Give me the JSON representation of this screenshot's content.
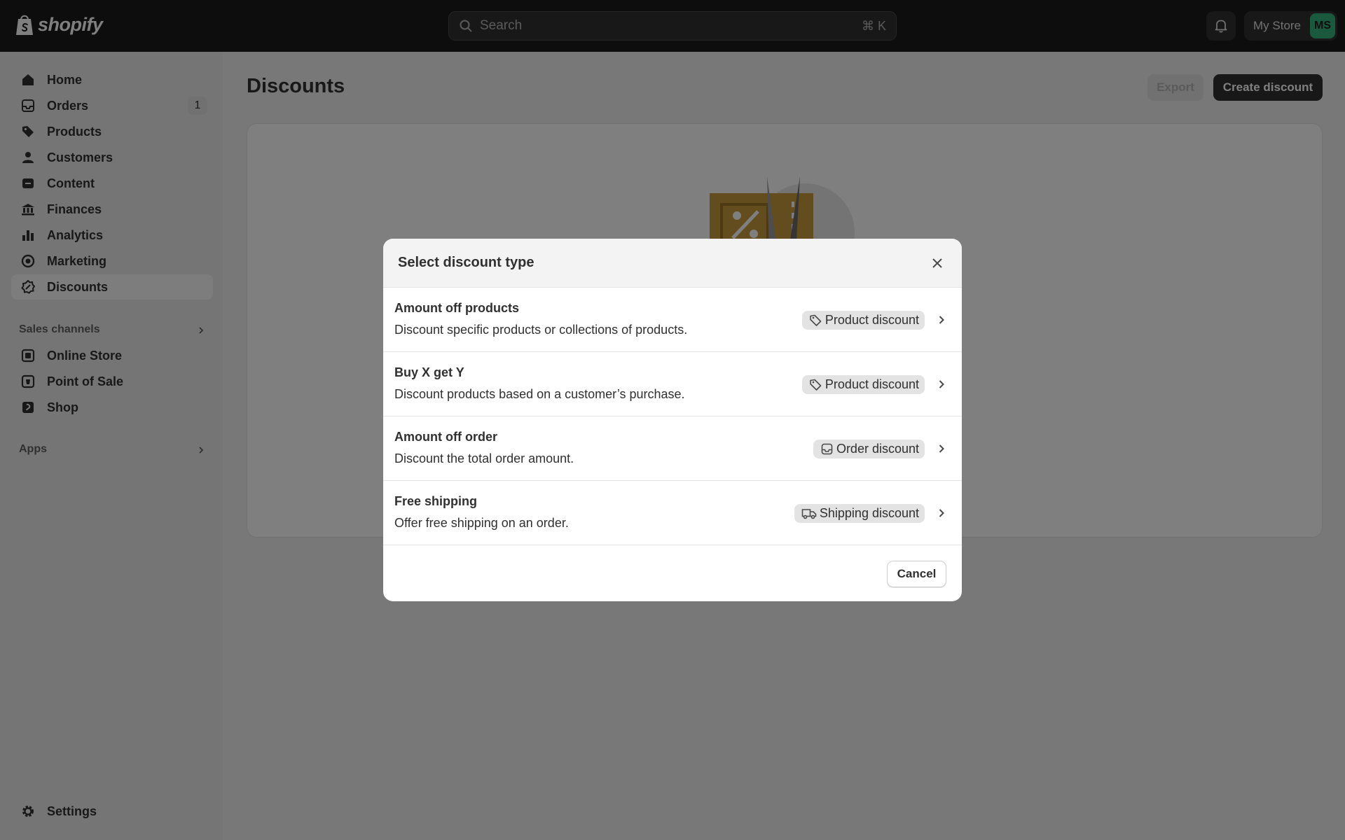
{
  "topbar": {
    "logo_text": "shopify",
    "search_placeholder": "Search",
    "search_shortcut": "⌘ K",
    "store_name": "My Store",
    "avatar_initials": "MS"
  },
  "sidebar": {
    "items": [
      {
        "label": "Home",
        "icon": "home-icon"
      },
      {
        "label": "Orders",
        "icon": "orders-icon",
        "badge": "1"
      },
      {
        "label": "Products",
        "icon": "tag-icon"
      },
      {
        "label": "Customers",
        "icon": "person-icon"
      },
      {
        "label": "Content",
        "icon": "content-icon"
      },
      {
        "label": "Finances",
        "icon": "bank-icon"
      },
      {
        "label": "Analytics",
        "icon": "bar-chart-icon"
      },
      {
        "label": "Marketing",
        "icon": "target-icon"
      },
      {
        "label": "Discounts",
        "icon": "discount-icon",
        "active": true
      }
    ],
    "sales_channels_label": "Sales channels",
    "channels": [
      {
        "label": "Online Store",
        "icon": "online-store-icon"
      },
      {
        "label": "Point of Sale",
        "icon": "pos-icon"
      },
      {
        "label": "Shop",
        "icon": "shop-icon"
      }
    ],
    "apps_label": "Apps",
    "settings_label": "Settings"
  },
  "main": {
    "title": "Discounts",
    "export_label": "Export",
    "create_label": "Create discount"
  },
  "modal": {
    "title": "Select discount type",
    "options": [
      {
        "title": "Amount off products",
        "description": "Discount specific products or collections of products.",
        "badge": "Product discount",
        "badge_icon": "tag-icon"
      },
      {
        "title": "Buy X get Y",
        "description": "Discount products based on a customer’s purchase.",
        "badge": "Product discount",
        "badge_icon": "tag-icon"
      },
      {
        "title": "Amount off order",
        "description": "Discount the total order amount.",
        "badge": "Order discount",
        "badge_icon": "order-icon"
      },
      {
        "title": "Free shipping",
        "description": "Offer free shipping on an order.",
        "badge": "Shipping discount",
        "badge_icon": "truck-icon"
      }
    ],
    "cancel_label": "Cancel"
  },
  "colors": {
    "topbar_bg": "#1a1a1a",
    "sidebar_bg": "#ebebeb",
    "primary_button": "#303030",
    "avatar_bg": "#36b37e",
    "illustration_accent": "#c79a3c"
  }
}
